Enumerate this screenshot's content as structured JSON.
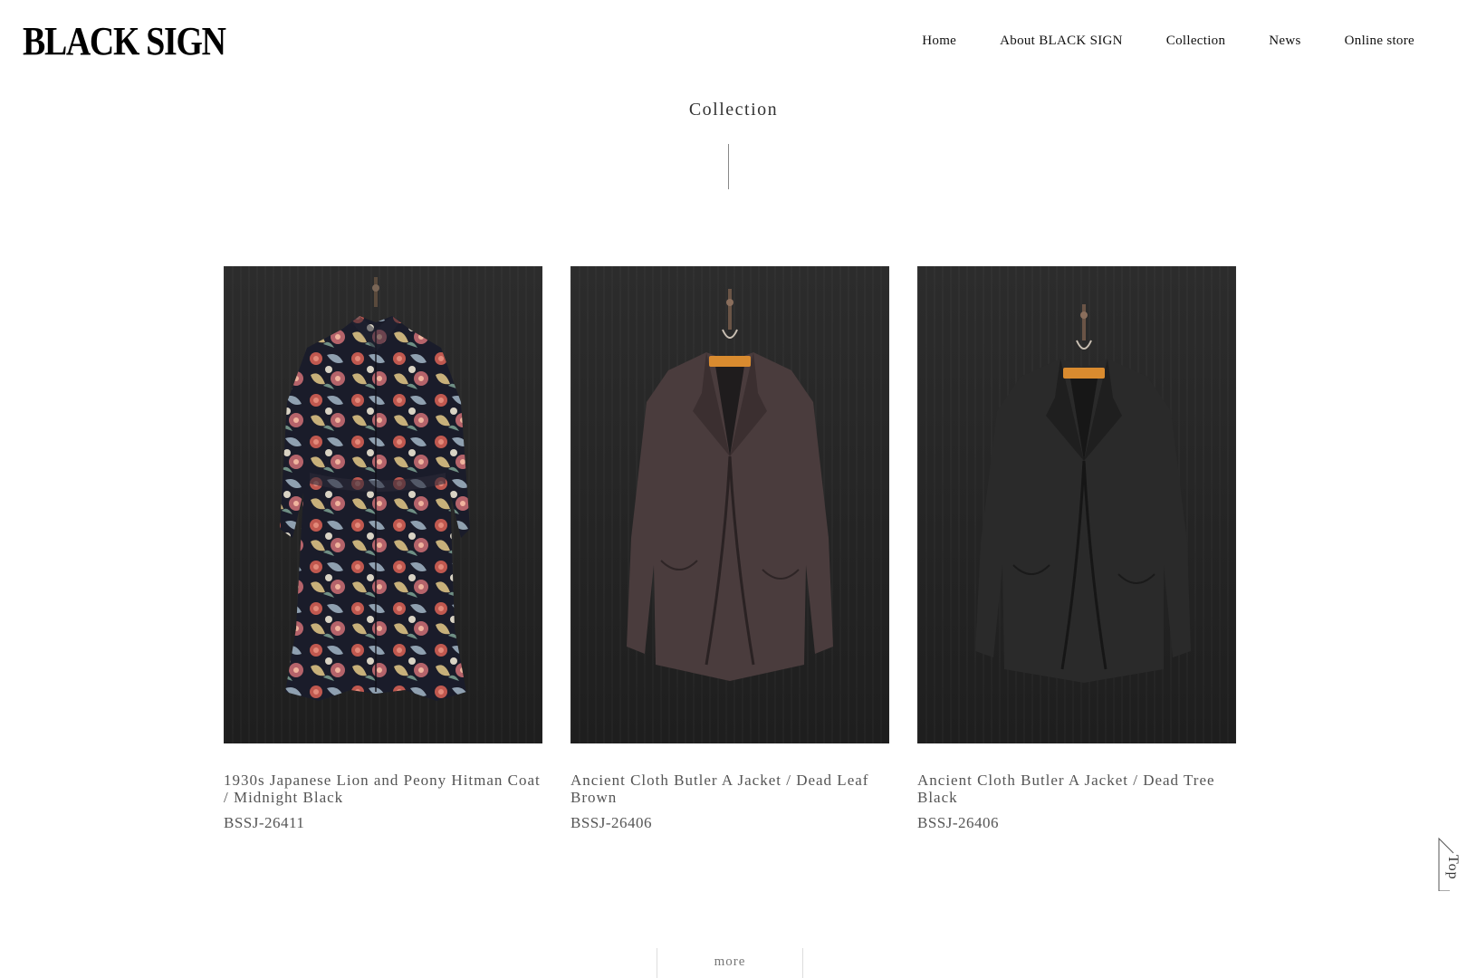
{
  "header": {
    "logo": "BLACK SIGN",
    "nav": [
      "Home",
      "About BLACK SIGN",
      "Collection",
      "News",
      "Online store"
    ]
  },
  "section": {
    "title": "Collection"
  },
  "items": [
    {
      "name": "1930s Japanese Lion and Peony Hitman Coat / Midnight Black",
      "code": "BSSJ-26411",
      "image": "floral-coat"
    },
    {
      "name": "Ancient Cloth Butler A Jacket / Dead Leaf Brown",
      "code": "BSSJ-26406",
      "image": "brown-jacket"
    },
    {
      "name": "Ancient Cloth Butler A Jacket / Dead Tree Black",
      "code": "BSSJ-26406",
      "image": "black-jacket"
    }
  ],
  "more_label": "more",
  "top_label": "Top"
}
